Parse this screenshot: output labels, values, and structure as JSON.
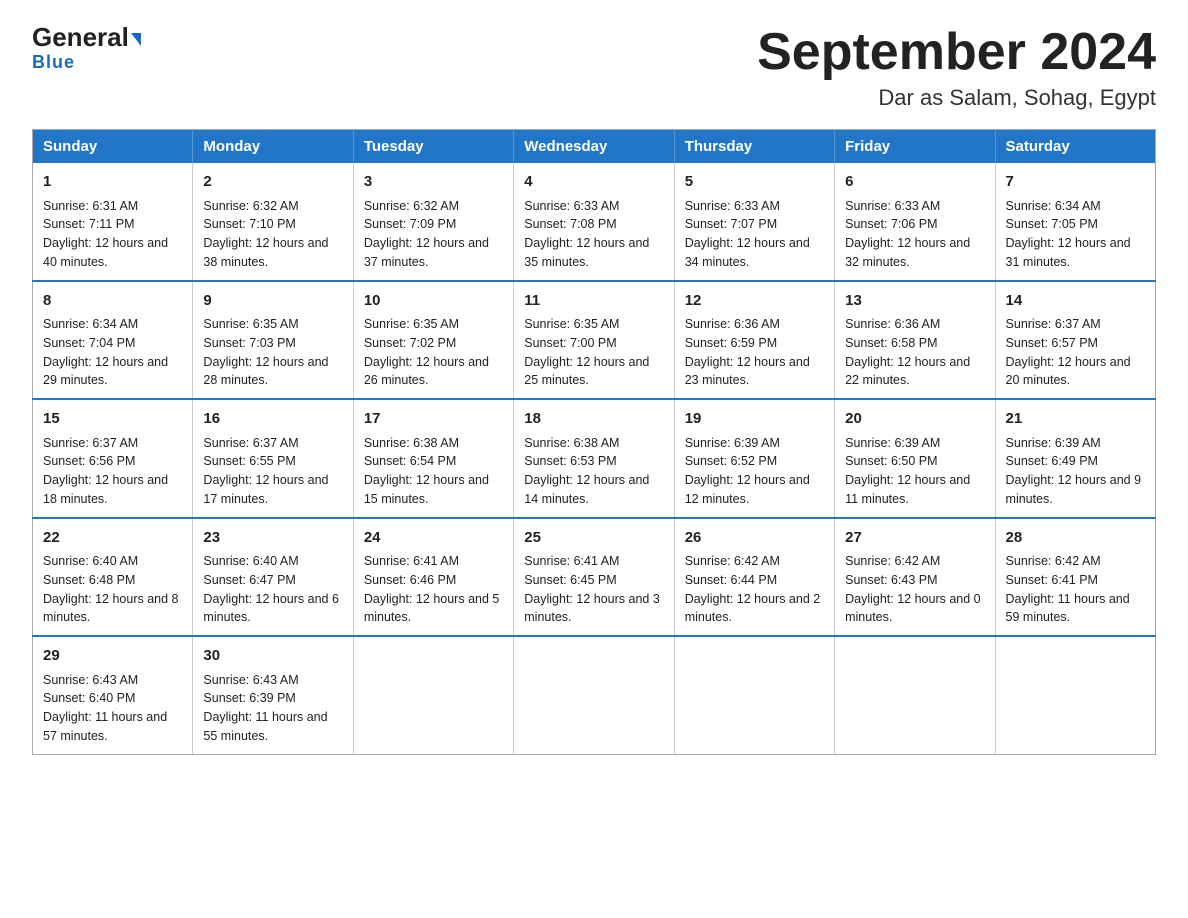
{
  "logo": {
    "brand": "General",
    "brand2": "Blue"
  },
  "title": {
    "month_year": "September 2024",
    "location": "Dar as Salam, Sohag, Egypt"
  },
  "days_of_week": [
    "Sunday",
    "Monday",
    "Tuesday",
    "Wednesday",
    "Thursday",
    "Friday",
    "Saturday"
  ],
  "weeks": [
    [
      {
        "day": 1,
        "sunrise": "6:31 AM",
        "sunset": "7:11 PM",
        "daylight": "12 hours and 40 minutes."
      },
      {
        "day": 2,
        "sunrise": "6:32 AM",
        "sunset": "7:10 PM",
        "daylight": "12 hours and 38 minutes."
      },
      {
        "day": 3,
        "sunrise": "6:32 AM",
        "sunset": "7:09 PM",
        "daylight": "12 hours and 37 minutes."
      },
      {
        "day": 4,
        "sunrise": "6:33 AM",
        "sunset": "7:08 PM",
        "daylight": "12 hours and 35 minutes."
      },
      {
        "day": 5,
        "sunrise": "6:33 AM",
        "sunset": "7:07 PM",
        "daylight": "12 hours and 34 minutes."
      },
      {
        "day": 6,
        "sunrise": "6:33 AM",
        "sunset": "7:06 PM",
        "daylight": "12 hours and 32 minutes."
      },
      {
        "day": 7,
        "sunrise": "6:34 AM",
        "sunset": "7:05 PM",
        "daylight": "12 hours and 31 minutes."
      }
    ],
    [
      {
        "day": 8,
        "sunrise": "6:34 AM",
        "sunset": "7:04 PM",
        "daylight": "12 hours and 29 minutes."
      },
      {
        "day": 9,
        "sunrise": "6:35 AM",
        "sunset": "7:03 PM",
        "daylight": "12 hours and 28 minutes."
      },
      {
        "day": 10,
        "sunrise": "6:35 AM",
        "sunset": "7:02 PM",
        "daylight": "12 hours and 26 minutes."
      },
      {
        "day": 11,
        "sunrise": "6:35 AM",
        "sunset": "7:00 PM",
        "daylight": "12 hours and 25 minutes."
      },
      {
        "day": 12,
        "sunrise": "6:36 AM",
        "sunset": "6:59 PM",
        "daylight": "12 hours and 23 minutes."
      },
      {
        "day": 13,
        "sunrise": "6:36 AM",
        "sunset": "6:58 PM",
        "daylight": "12 hours and 22 minutes."
      },
      {
        "day": 14,
        "sunrise": "6:37 AM",
        "sunset": "6:57 PM",
        "daylight": "12 hours and 20 minutes."
      }
    ],
    [
      {
        "day": 15,
        "sunrise": "6:37 AM",
        "sunset": "6:56 PM",
        "daylight": "12 hours and 18 minutes."
      },
      {
        "day": 16,
        "sunrise": "6:37 AM",
        "sunset": "6:55 PM",
        "daylight": "12 hours and 17 minutes."
      },
      {
        "day": 17,
        "sunrise": "6:38 AM",
        "sunset": "6:54 PM",
        "daylight": "12 hours and 15 minutes."
      },
      {
        "day": 18,
        "sunrise": "6:38 AM",
        "sunset": "6:53 PM",
        "daylight": "12 hours and 14 minutes."
      },
      {
        "day": 19,
        "sunrise": "6:39 AM",
        "sunset": "6:52 PM",
        "daylight": "12 hours and 12 minutes."
      },
      {
        "day": 20,
        "sunrise": "6:39 AM",
        "sunset": "6:50 PM",
        "daylight": "12 hours and 11 minutes."
      },
      {
        "day": 21,
        "sunrise": "6:39 AM",
        "sunset": "6:49 PM",
        "daylight": "12 hours and 9 minutes."
      }
    ],
    [
      {
        "day": 22,
        "sunrise": "6:40 AM",
        "sunset": "6:48 PM",
        "daylight": "12 hours and 8 minutes."
      },
      {
        "day": 23,
        "sunrise": "6:40 AM",
        "sunset": "6:47 PM",
        "daylight": "12 hours and 6 minutes."
      },
      {
        "day": 24,
        "sunrise": "6:41 AM",
        "sunset": "6:46 PM",
        "daylight": "12 hours and 5 minutes."
      },
      {
        "day": 25,
        "sunrise": "6:41 AM",
        "sunset": "6:45 PM",
        "daylight": "12 hours and 3 minutes."
      },
      {
        "day": 26,
        "sunrise": "6:42 AM",
        "sunset": "6:44 PM",
        "daylight": "12 hours and 2 minutes."
      },
      {
        "day": 27,
        "sunrise": "6:42 AM",
        "sunset": "6:43 PM",
        "daylight": "12 hours and 0 minutes."
      },
      {
        "day": 28,
        "sunrise": "6:42 AM",
        "sunset": "6:41 PM",
        "daylight": "11 hours and 59 minutes."
      }
    ],
    [
      {
        "day": 29,
        "sunrise": "6:43 AM",
        "sunset": "6:40 PM",
        "daylight": "11 hours and 57 minutes."
      },
      {
        "day": 30,
        "sunrise": "6:43 AM",
        "sunset": "6:39 PM",
        "daylight": "11 hours and 55 minutes."
      },
      null,
      null,
      null,
      null,
      null
    ]
  ]
}
